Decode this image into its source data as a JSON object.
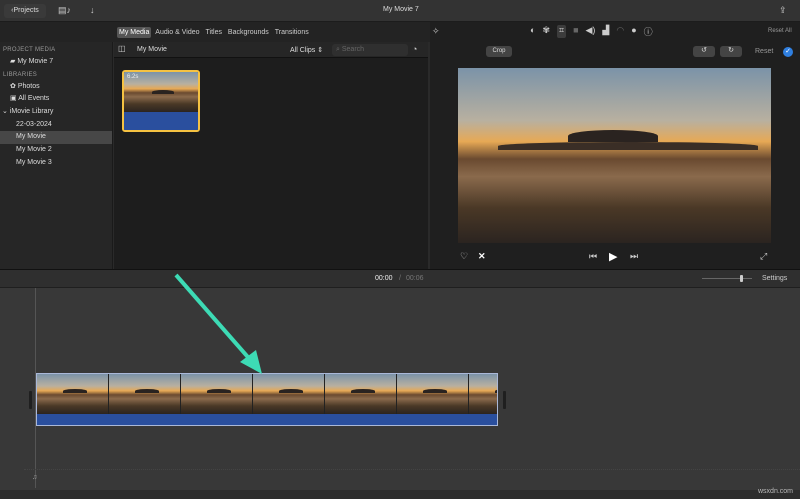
{
  "toolbar": {
    "projects": "Projects",
    "title": "My Movie 7"
  },
  "tabs": [
    "My Media",
    "Audio & Video",
    "Titles",
    "Backgrounds",
    "Transitions"
  ],
  "sidebar": {
    "project_media": "PROJECT MEDIA",
    "project": "My Movie 7",
    "libraries": "LIBRARIES",
    "photos": "Photos",
    "all_events": "All Events",
    "library": "iMovie Library",
    "events": [
      "22-03-2024",
      "My Movie",
      "My Movie 2",
      "My Movie 3"
    ]
  },
  "browser": {
    "title": "My Movie",
    "filter": "All Clips",
    "search_placeholder": "Search",
    "clip_duration": "6.2s"
  },
  "viewer": {
    "reset_all": "Reset All",
    "crop": "Crop",
    "reset": "Reset"
  },
  "timeline": {
    "current": "00:00",
    "separator": "/",
    "total": "00:06",
    "settings": "Settings"
  },
  "watermark": "wsxdn.com",
  "colors": {
    "accent": "#2f7fe0",
    "arrow": "#3ddbb5",
    "clip_audio": "#2a4f9e",
    "selection": "#f5c242"
  }
}
